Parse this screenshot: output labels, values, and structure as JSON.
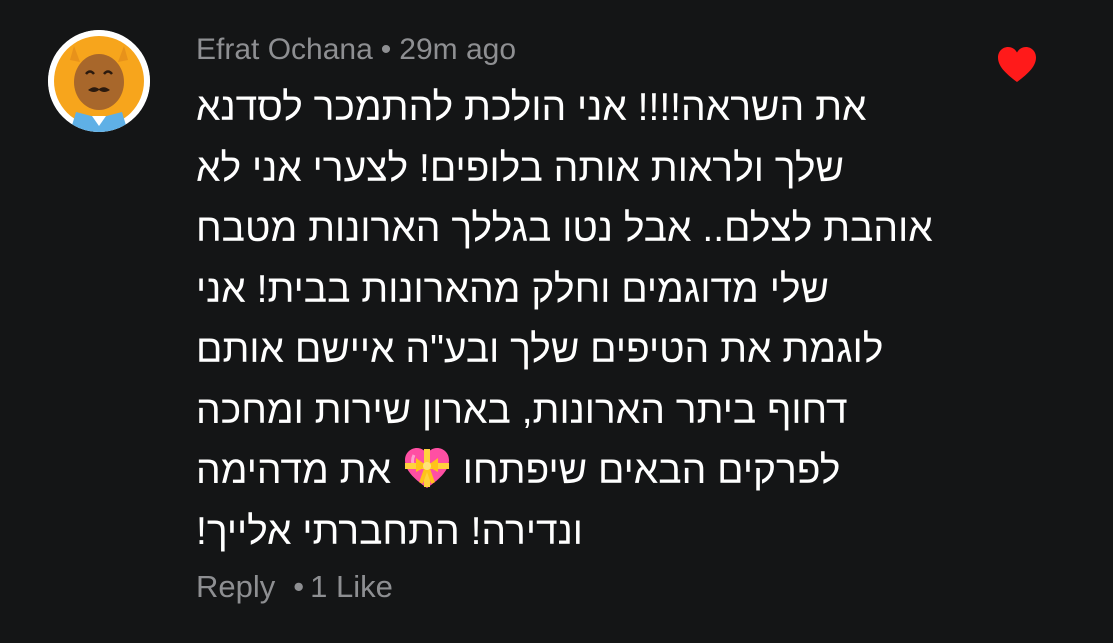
{
  "comment": {
    "author": "Efrat Ochana",
    "separator": "•",
    "time_ago": "29m ago",
    "lines": [
      "את השראה!!!! אני הולכת להתמכר לסדנא",
      "שלך ולראות אותה בלופים! לצערי אני לא",
      "אוהבת לצלם.. אבל נטו בגללך הארונות מטבח",
      "שלי מדוגמים וחלק מהארונות בבית! אני",
      "לוגמת את הטיפים שלך ובע\"ה איישם אותם",
      "דחוף ביתר הארונות, בארון שירות ומחכה",
      "לפרקים הבאים שיפתחו",
      "את מדהימה",
      "ונדירה! התחברתי אלייך!"
    ],
    "emoji": "heart-with-ribbon-icon",
    "liked": true,
    "like_color": "#ff1a1a"
  },
  "footer": {
    "reply_label": "Reply",
    "dot": "•",
    "likes_label": "1 Like"
  },
  "colors": {
    "background": "#141516",
    "meta_text": "#8e8f92",
    "text": "#ffffff",
    "avatar_bg": "#f7a51c"
  }
}
